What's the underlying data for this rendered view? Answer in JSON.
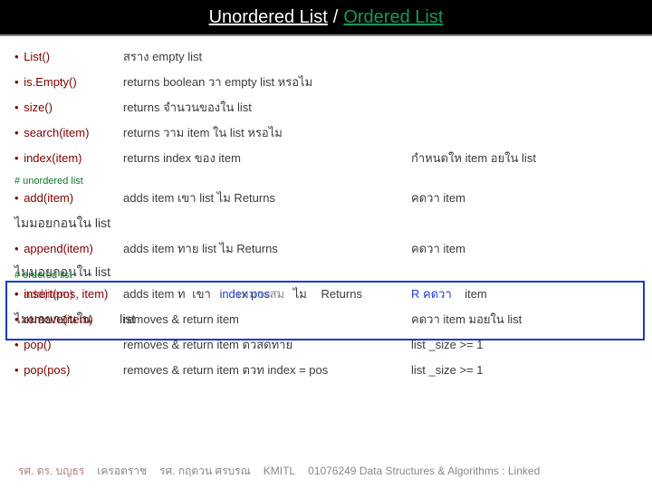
{
  "title": {
    "left": "Unordered  List",
    "sep": "/",
    "right": "Ordered List"
  },
  "rows": [
    {
      "method": "List()",
      "desc": "สราง   empty list",
      "cond": ""
    },
    {
      "method": "is.Empty()",
      "desc": "returns boolean  วา    empty list หรอไม",
      "cond": ""
    },
    {
      "method": "size()",
      "desc": "returns จำนวนของใน     list",
      "cond": ""
    },
    {
      "method": "search(item)",
      "desc": "returns วาม       item ใน list หรอไม",
      "cond": ""
    },
    {
      "method": "index(item)",
      "desc": "returns index ของ item",
      "cond": "กำหนดให      item อยใน      list"
    }
  ],
  "comment1": "# unordered list",
  "add": {
    "method": "add(item)",
    "desc": "adds item เขา    list    ไม    Returns",
    "cond": "คดวา       item"
  },
  "addNote": "ไมมอยกอนใน             list",
  "append": {
    "method": "append(item)",
    "desc": "adds item ทาย    list    ไม    Returns",
    "cond": "คดวา       item"
  },
  "appendNote": "ไมมอยกอนใน             list",
  "comment2": "# ordered list",
  "mixed": {
    "left1": "add(item)",
    "left2": "insert(pos, item)",
    "mid": "adds item ท",
    "mid2": "เขา",
    "blue1": "index  pos",
    "mid3": "เหมาะสม",
    "mid4": "ไม",
    "mid5": "Returns",
    "blue2": "R คดวา",
    "cond": "item"
  },
  "mixedNoteLeft": "ไมมอยกอนใน",
  "mixedNoteList": "list",
  "remove": {
    "method": "remove(item)",
    "desc": "removes & return item",
    "cond": "คดวา     item มอยใน          list"
  },
  "pop0": {
    "method": "pop()",
    "desc": "removes & return item ตวสดทาย",
    "cond": "list _size >= 1"
  },
  "pop1": {
    "method": "pop(pos)",
    "desc": "removes & return item ตวท        index = pos",
    "cond": "list _size >= 1"
  },
  "footer": {
    "a": "รศ. ดร. บญธร",
    "b": "เครอตราช",
    "c": "รศ. กฤตวน  ศรบรณ",
    "d": "KMITL",
    "e": "01076249 Data Structures & Algorithms : Linked"
  }
}
